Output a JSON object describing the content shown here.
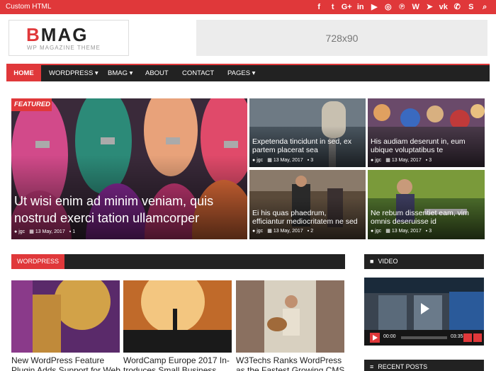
{
  "topbar": {
    "custom_html": "Custom HTML",
    "social_icons": [
      "facebook-icon",
      "twitter-icon",
      "google-plus-icon",
      "linkedin-icon",
      "youtube-icon",
      "instagram-icon",
      "pinterest-icon",
      "wordpress-icon",
      "telegram-icon",
      "vk-icon",
      "whatsapp-icon",
      "skype-icon",
      "search-icon"
    ],
    "social_glyphs": [
      "f",
      "t",
      "G+",
      "in",
      "▶",
      "◎",
      "℗",
      "W",
      "➤",
      "vk",
      "✆",
      "S",
      "⌕"
    ]
  },
  "header": {
    "logo_title_accent": "B",
    "logo_title_rest": "MAG",
    "logo_subtitle": "WP MAGAZINE THEME",
    "ad_label": "728x90"
  },
  "nav": {
    "items": [
      {
        "label": "HOME"
      },
      {
        "label": "WORDPRESS ▾"
      },
      {
        "label": "BMAG ▾"
      },
      {
        "label": "ABOUT"
      },
      {
        "label": "CONTACT"
      },
      {
        "label": "PAGES ▾"
      }
    ]
  },
  "featured": {
    "badge": "FEATURED",
    "main": {
      "title": "Ut wisi enim ad minim veniam, quis nostrud exerci tation ullamcorper",
      "author": "jgc",
      "date": "13 May, 2017",
      "comments": "1"
    },
    "small": [
      {
        "title": "Expetenda tincidunt in sed, ex partem placerat sea",
        "author": "jgc",
        "date": "13 May, 2017",
        "comments": "3"
      },
      {
        "title": "His audiam deserunt in, eum ubique voluptatibus te",
        "author": "jgc",
        "date": "13 May, 2017",
        "comments": "3"
      },
      {
        "title": "Ei his quas phaedrum, efficiantur mediocritatem ne sed",
        "author": "jgc",
        "date": "13 May, 2017",
        "comments": "2"
      },
      {
        "title": "Ne rebum dissentiet eam, vim omnis deseruisse id",
        "author": "jgc",
        "date": "13 May, 2017",
        "comments": "3"
      }
    ]
  },
  "wordpress_section": {
    "label": "WORDPRESS",
    "posts": [
      {
        "title": "New WordPress Feature Plugin Adds Support for Web"
      },
      {
        "title": "WordCamp Europe 2017 In-troduces Small Business"
      },
      {
        "title": "W3Techs Ranks WordPress as the Fastest Growing CMS"
      }
    ]
  },
  "sidebar": {
    "video_label": "VIDEO",
    "video_time_current": "00:00",
    "video_time_total": "03:35",
    "recent_posts_label": "RECENT POSTS"
  },
  "colors": {
    "accent": "#e0383a",
    "dark": "#222222"
  }
}
